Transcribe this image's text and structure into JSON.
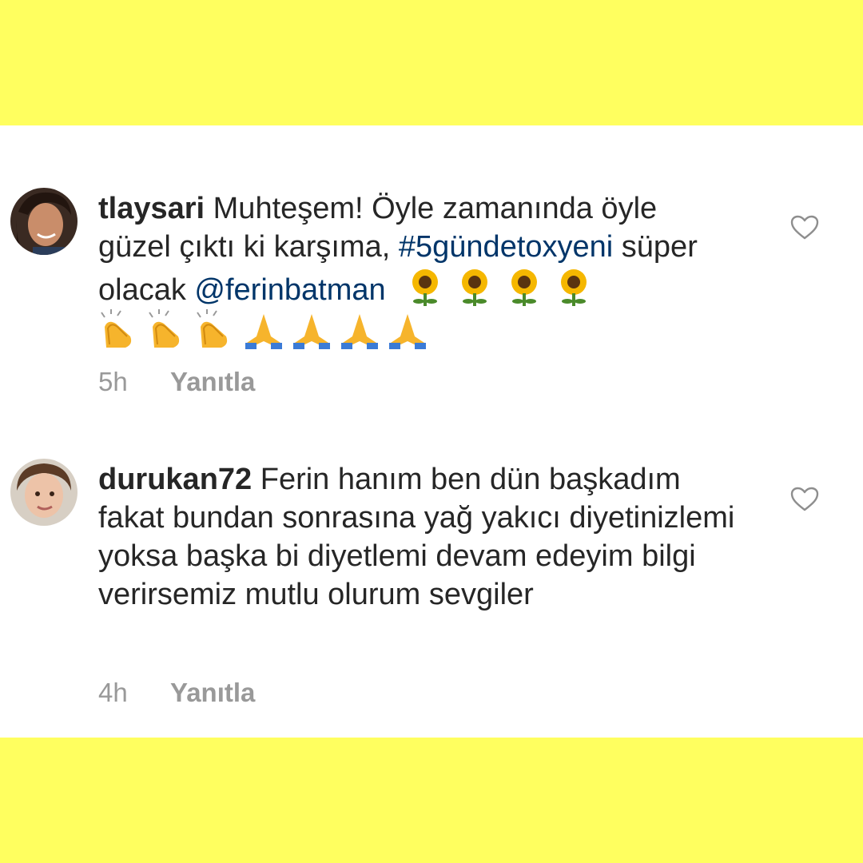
{
  "comments": [
    {
      "username": "tlaysari",
      "text_part1": " Muhteşem! Öyle zamanında öyle güzel çıktı ki karşıma, ",
      "hashtag": "#5gündetoxyeni",
      "text_part2": " süper olacak ",
      "mention": "@ferinbatman",
      "emojis": [
        "sunflower",
        "sunflower",
        "sunflower",
        "sunflower",
        "clapping-hands",
        "clapping-hands",
        "clapping-hands",
        "folded-hands",
        "folded-hands",
        "folded-hands",
        "folded-hands"
      ],
      "time": "5h",
      "reply_label": "Yanıtla",
      "like_icon": "heart-outline-icon"
    },
    {
      "username": "durukan72",
      "text": " Ferin hanım ben dün başkadım fakat bundan sonrasına yağ yakıcı diyetinizlemi yoksa başka bi diyetlemi devam edeyim bilgi verirsemiz mutlu olurum sevgiler",
      "time": "4h",
      "reply_label": "Yanıtla",
      "like_icon": "heart-outline-icon"
    }
  ],
  "colors": {
    "background": "#ffff5f",
    "panel": "#ffffff",
    "text": "#262626",
    "link": "#003569",
    "meta": "#999999"
  }
}
